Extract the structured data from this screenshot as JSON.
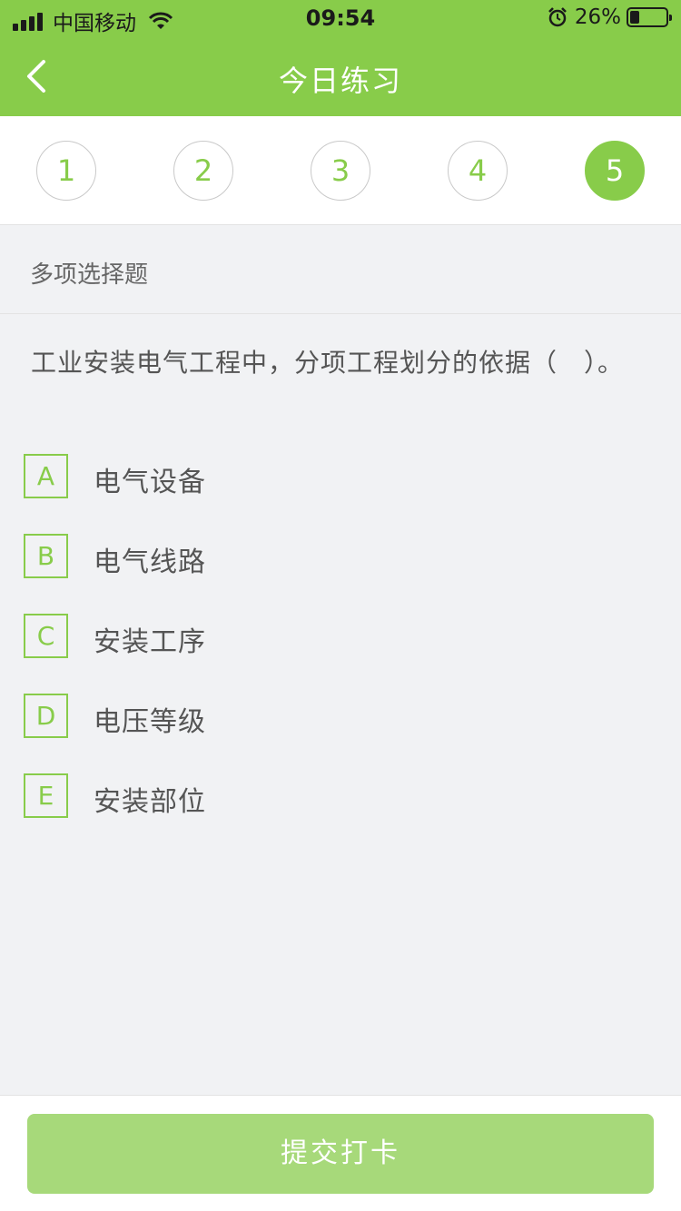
{
  "status_bar": {
    "carrier": "中国移动",
    "time": "09:54",
    "battery": "26%",
    "battery_level": 0.26,
    "icons": [
      "signal-icon",
      "wifi-icon",
      "alarm-icon",
      "battery-icon"
    ]
  },
  "nav": {
    "title": "今日练习",
    "back_icon": "chevron-left-icon"
  },
  "steps": [
    {
      "label": "1",
      "active": false
    },
    {
      "label": "2",
      "active": false
    },
    {
      "label": "3",
      "active": false
    },
    {
      "label": "4",
      "active": false
    },
    {
      "label": "5",
      "active": true
    }
  ],
  "question": {
    "type": "多项选择题",
    "text": "工业安装电气工程中，分项工程划分的依据（　）。",
    "options": [
      {
        "letter": "A",
        "text": "电气设备"
      },
      {
        "letter": "B",
        "text": "电气线路"
      },
      {
        "letter": "C",
        "text": "安装工序"
      },
      {
        "letter": "D",
        "text": "电压等级"
      },
      {
        "letter": "E",
        "text": "安装部位"
      }
    ]
  },
  "footer": {
    "submit_label": "提交打卡"
  },
  "colors": {
    "accent": "#88cc4a",
    "submit_bg": "#a7d97a",
    "page_bg": "#f1f2f4"
  }
}
